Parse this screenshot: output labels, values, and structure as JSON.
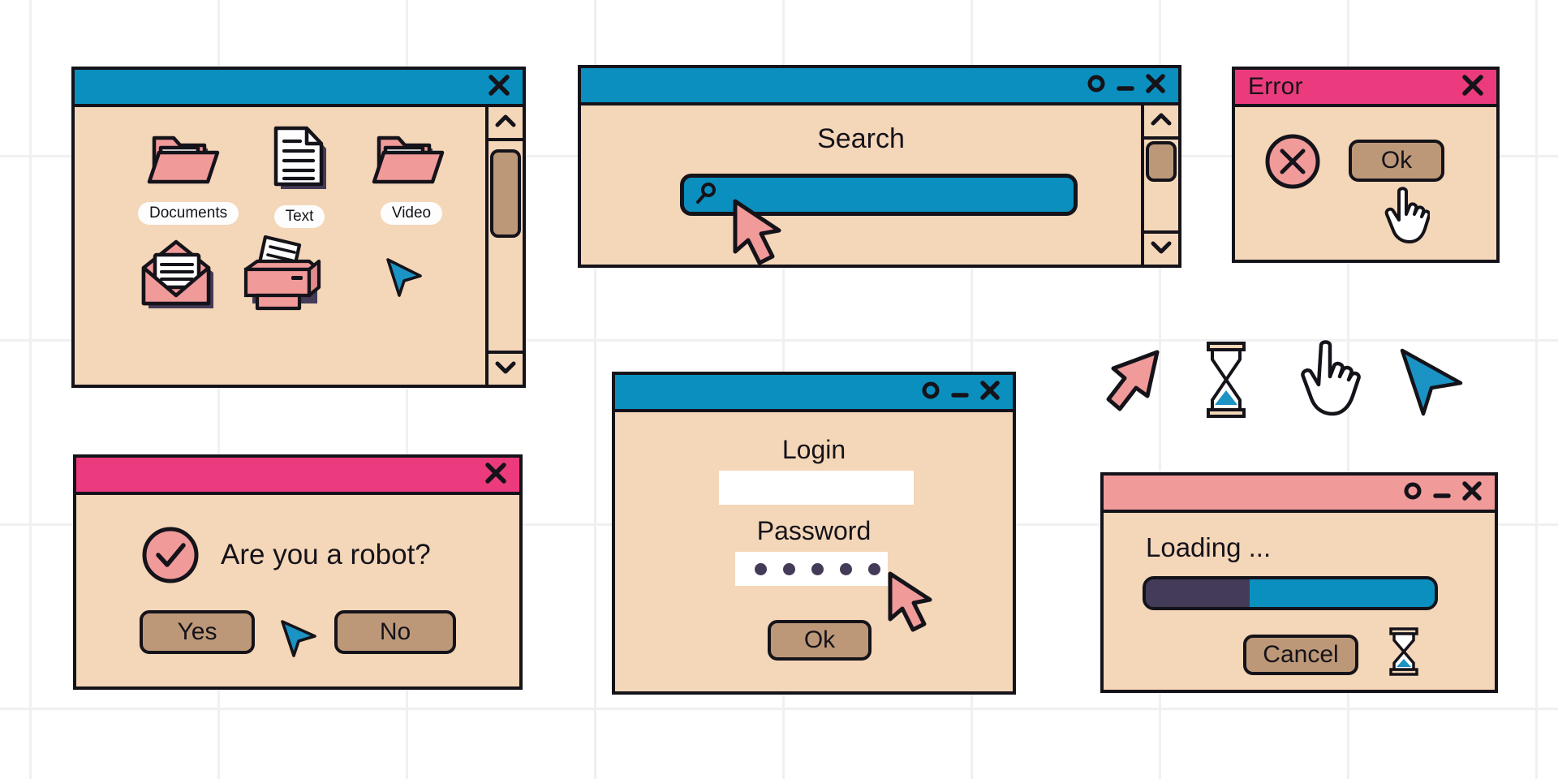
{
  "theme": {
    "accent_blue": "#0b8fbe",
    "accent_pink": "#eb3b7e",
    "accent_salmon": "#f09a9a",
    "window_bg": "#f4d6b8",
    "outline": "#15131a",
    "shadow": "#433b57",
    "button_bg": "#bd9878",
    "icon_pink": "#f09a9a",
    "grid_line": "#f0f0f0",
    "page_bg": "#ffffff"
  },
  "file_explorer": {
    "title": "",
    "controls": [
      "close"
    ],
    "icons": [
      {
        "label": "Documents",
        "icon": "folder-icon"
      },
      {
        "label": "Text",
        "icon": "document-icon"
      },
      {
        "label": "Video",
        "icon": "folder-icon"
      },
      {
        "label": "",
        "icon": "mail-icon"
      },
      {
        "label": "",
        "icon": "printer-icon"
      }
    ],
    "scrollbar": {
      "up": "chevron-up-icon",
      "down": "chevron-down-icon",
      "thumb_top_pct": 4,
      "thumb_height_pct": 42
    },
    "cursor": "arrow-blue-cursor"
  },
  "search_window": {
    "title": "",
    "controls": [
      "maximize",
      "minimize",
      "close"
    ],
    "heading": "Search",
    "input_value": "",
    "input_placeholder": "",
    "search_icon": "magnifier-icon",
    "scrollbar": {
      "up": "chevron-up-icon",
      "down": "chevron-down-icon",
      "thumb_top_pct": 8,
      "thumb_height_pct": 32
    },
    "cursor": "arrow-pink-cursor"
  },
  "error_dialog": {
    "title": "Error",
    "controls": [
      "close"
    ],
    "status_icon": "error-circle-x-icon",
    "ok_label": "Ok",
    "cursor": "hand-pointer-cursor"
  },
  "robot_dialog": {
    "title": "",
    "controls": [
      "close"
    ],
    "status_icon": "check-circle-icon",
    "message": "Are you a robot?",
    "yes_label": "Yes",
    "no_label": "No",
    "cursor": "arrow-blue-cursor"
  },
  "login_window": {
    "title": "",
    "controls": [
      "maximize",
      "minimize",
      "close"
    ],
    "login_label": "Login",
    "login_value": "",
    "password_label": "Password",
    "password_value": "•••••",
    "password_dots": 5,
    "ok_label": "Ok",
    "cursor": "arrow-pink-cursor"
  },
  "loading_window": {
    "title": "",
    "controls": [
      "maximize",
      "minimize",
      "close"
    ],
    "status_text": "Loading ...",
    "progress_percent": 36,
    "cancel_label": "Cancel",
    "hourglass_icon": "hourglass-icon"
  },
  "cursor_set": [
    {
      "name": "arrow-pink-cursor"
    },
    {
      "name": "hourglass-icon"
    },
    {
      "name": "hand-pointer-cursor"
    },
    {
      "name": "arrow-blue-cursor"
    }
  ]
}
